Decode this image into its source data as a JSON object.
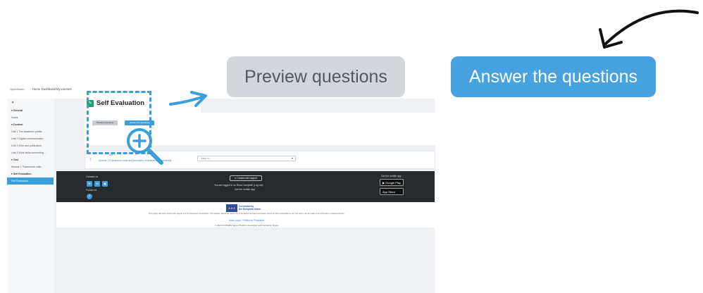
{
  "topnav": {
    "logo": "OpenHome",
    "items": [
      "Home",
      "Dashboard",
      "My courses"
    ]
  },
  "sidebar": {
    "items": [
      {
        "label": "General",
        "type": "section"
      },
      {
        "label": "Notes",
        "type": "item"
      },
      {
        "label": "Content",
        "type": "section"
      },
      {
        "label": "Unit 1 The academic profile ...",
        "type": "item"
      },
      {
        "label": "Unit 2 Digital communication",
        "type": "item"
      },
      {
        "label": "Unit 3 Web and publication",
        "type": "item"
      },
      {
        "label": "Unit 4 Work skills connecting ...",
        "type": "item"
      },
      {
        "label": "Test",
        "type": "section"
      },
      {
        "label": "Module 1 Framework unite...",
        "type": "item"
      },
      {
        "label": "Self Evaluation",
        "type": "section"
      }
    ],
    "active": "Self Evaluation"
  },
  "page": {
    "title": "Self Evaluation",
    "preview_btn": "Preview questions",
    "answer_btn": "Answer the questions"
  },
  "activity_nav": {
    "prev_label": "Ant...",
    "prev_link": "Module 1 Framework unite and principles of reliable environmental.",
    "jump_placeholder": "Jump to..."
  },
  "footer": {
    "contact_us": "Contact us",
    "follow_us": "Follow us",
    "contact_support": "Contact site support",
    "logged_in": "You are logged in as Rosa Campbell (Log out)",
    "get_app": "Get the mobile app",
    "get_mobile_app": "Get the mobile app",
    "google_play": "Google Play",
    "app_store": "App Store",
    "eu_line1": "Co-funded by",
    "eu_line2": "the European Union",
    "disclaimer": "This project has been funded with support from the European Commission. This website reflects the views only of the author and the Commission cannot be held responsible for any use which may be made of the information contained therein.",
    "links": "Aviso Legal · Politica de Privacidad",
    "copyright": "© 2022 OCOMMS Senior Platform developed and Fundación Itinera"
  },
  "annotations": {
    "preview_big": "Preview questions",
    "answer_big": "Answer the questions"
  },
  "colors": {
    "accent_blue": "#46a3e0",
    "grey_button": "#d3d6da",
    "footer_dark": "#272a2d"
  }
}
